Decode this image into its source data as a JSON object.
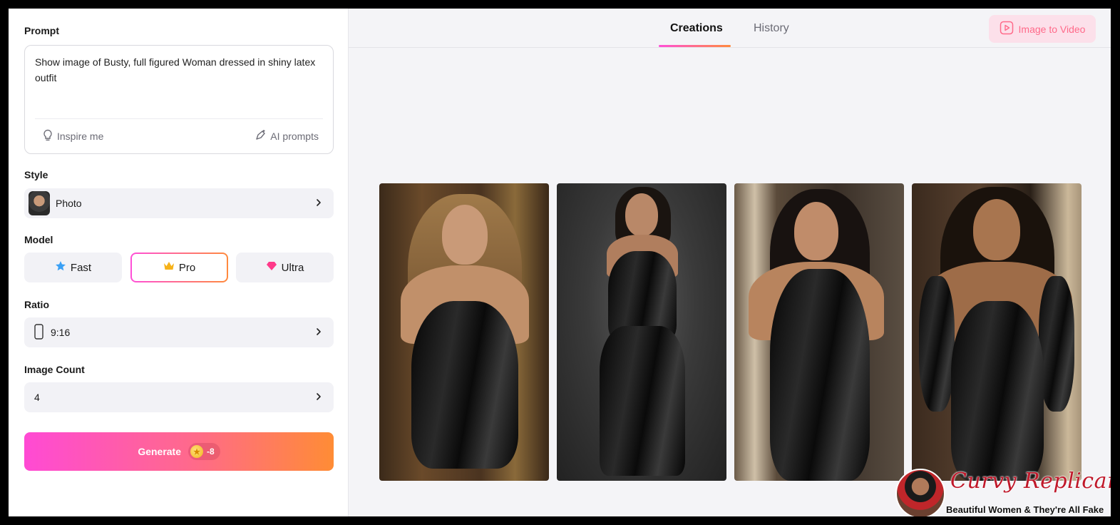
{
  "prompt": {
    "label": "Prompt",
    "value": "Show image of Busty, full figured Woman dressed in shiny latex outfit",
    "inspire_label": "Inspire me",
    "ai_prompts_label": "AI prompts"
  },
  "style": {
    "label": "Style",
    "value": "Photo"
  },
  "model": {
    "label": "Model",
    "options": [
      {
        "label": "Fast",
        "icon": "star-badge-icon"
      },
      {
        "label": "Pro",
        "icon": "crown-icon"
      },
      {
        "label": "Ultra",
        "icon": "diamond-icon"
      }
    ],
    "selected": "Pro"
  },
  "ratio": {
    "label": "Ratio",
    "value": "9:16"
  },
  "image_count": {
    "label": "Image Count",
    "value": "4"
  },
  "generate": {
    "label": "Generate",
    "cost": "-8"
  },
  "tabs": [
    {
      "label": "Creations",
      "active": true
    },
    {
      "label": "History",
      "active": false
    }
  ],
  "image_to_video": {
    "label": "Image to Video"
  },
  "images": [
    {
      "name": "generated-image-1"
    },
    {
      "name": "generated-image-2"
    },
    {
      "name": "generated-image-3"
    },
    {
      "name": "generated-image-4"
    }
  ],
  "watermark": {
    "title": "Curvy Replicants",
    "subtitle": "Beautiful Women & They're All Fake"
  },
  "colors": {
    "accent_start": "#ff4fd8",
    "accent_end": "#ff8a3d",
    "panel_bg": "#f4f4f7",
    "selector_bg": "#f2f2f6"
  }
}
